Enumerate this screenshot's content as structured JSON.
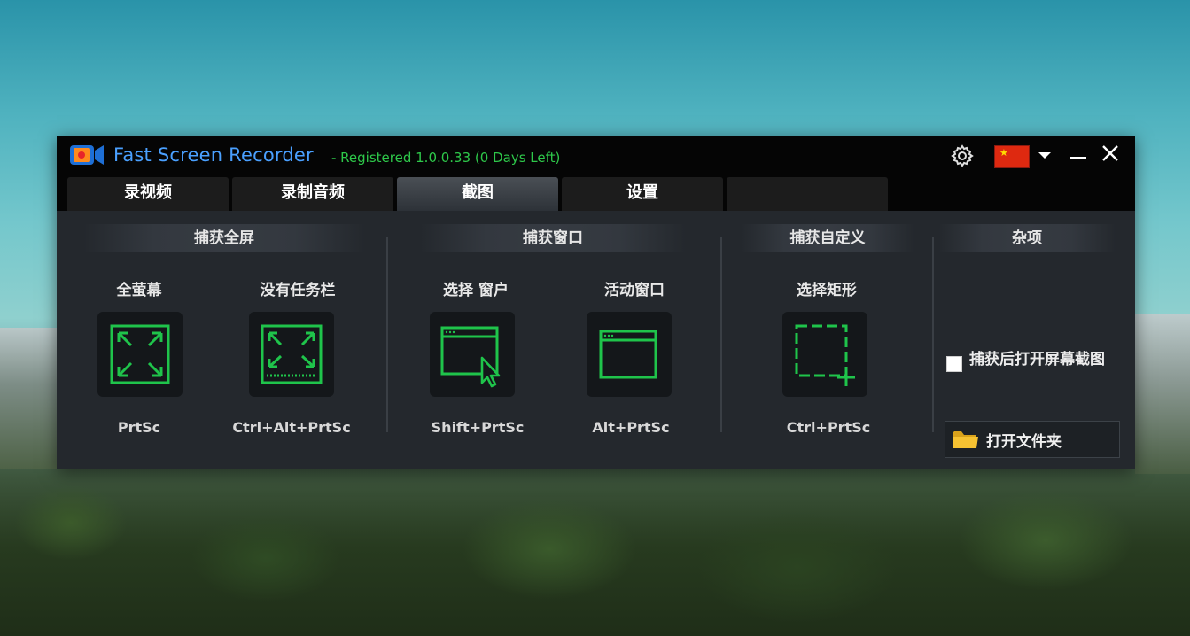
{
  "app": {
    "title": "Fast Screen Recorder",
    "registration": "- Registered 1.0.0.33 (0 Days Left)"
  },
  "tabs": [
    {
      "label": "录视频"
    },
    {
      "label": "录制音频"
    },
    {
      "label": "截图",
      "active": true
    },
    {
      "label": "设置"
    },
    {
      "label": ""
    }
  ],
  "sections": {
    "fullscreen": {
      "title": "捕获全屏",
      "items": [
        {
          "label": "全萤幕",
          "hotkey": "PrtSc",
          "icon": "fullscreen-icon"
        },
        {
          "label": "没有任务栏",
          "hotkey": "Ctrl+Alt+PrtSc",
          "icon": "fullscreen-no-taskbar-icon"
        }
      ]
    },
    "window": {
      "title": "捕获窗口",
      "items": [
        {
          "label": "选择 窗户",
          "hotkey": "Shift+PrtSc",
          "icon": "select-window-icon"
        },
        {
          "label": "活动窗口",
          "hotkey": "Alt+PrtSc",
          "icon": "active-window-icon"
        }
      ]
    },
    "custom": {
      "title": "捕获自定义",
      "items": [
        {
          "label": "选择矩形",
          "hotkey": "Ctrl+PrtSc",
          "icon": "select-rectangle-icon"
        }
      ]
    },
    "misc": {
      "title": "杂项",
      "checkbox_label": "捕获后打开屏幕截图",
      "checkbox_checked": false,
      "open_folder_label": "打开文件夹"
    }
  },
  "colors": {
    "accent_green": "#1fc44b",
    "title_blue": "#4aa0ff",
    "registration_green": "#2ec84a",
    "window_bg": "#24282d",
    "titlebar_bg": "#050505"
  },
  "icons": [
    "app-logo-icon",
    "gear-icon",
    "china-flag-icon",
    "chevron-down-icon",
    "minimize-icon",
    "close-icon",
    "folder-icon"
  ]
}
